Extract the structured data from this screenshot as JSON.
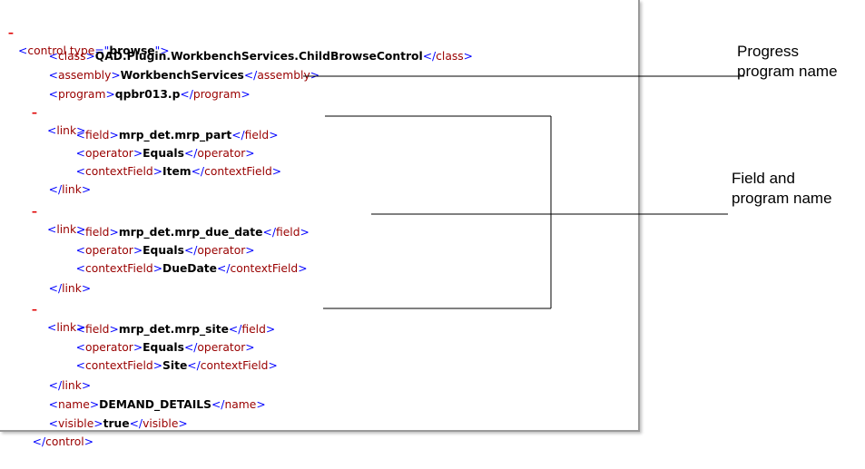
{
  "xml": {
    "root_open": {
      "toggle": "–",
      "lt": "<",
      "tag": "control",
      "attr_name": "type",
      "eq": "=\"",
      "attr_value": "browse",
      "close": "\">"
    },
    "class_line": {
      "open": "class",
      "value": "QAD.Plugin.WorkbenchServices.ChildBrowseControl"
    },
    "assembly_line": {
      "open": "assembly",
      "value": "WorkbenchServices"
    },
    "program_line": {
      "open": "program",
      "value": "qpbr013.p"
    },
    "links": [
      {
        "toggle": "–",
        "tag": "link",
        "field": {
          "tag": "field",
          "value": "mrp_det.mrp_part"
        },
        "operator": {
          "tag": "operator",
          "value": "Equals"
        },
        "context": {
          "tag": "contextField",
          "value": "Item"
        }
      },
      {
        "toggle": "–",
        "tag": "link",
        "field": {
          "tag": "field",
          "value": "mrp_det.mrp_due_date"
        },
        "operator": {
          "tag": "operator",
          "value": "Equals"
        },
        "context": {
          "tag": "contextField",
          "value": "DueDate"
        }
      },
      {
        "toggle": "–",
        "tag": "link",
        "field": {
          "tag": "field",
          "value": "mrp_det.mrp_site"
        },
        "operator": {
          "tag": "operator",
          "value": "Equals"
        },
        "context": {
          "tag": "contextField",
          "value": "Site"
        }
      }
    ],
    "name_line": {
      "open": "name",
      "value": "DEMAND_DETAILS"
    },
    "visible_line": {
      "open": "visible",
      "value": "true"
    },
    "root_close": "control"
  },
  "callouts": {
    "program": {
      "line1": "Progress",
      "line2": "program name"
    },
    "field": {
      "line1": "Field and",
      "line2": "program name"
    }
  },
  "colors": {
    "markup": "#0000ff",
    "element_name": "#990000",
    "toggle": "#e00000",
    "callout_line": "#000000"
  }
}
